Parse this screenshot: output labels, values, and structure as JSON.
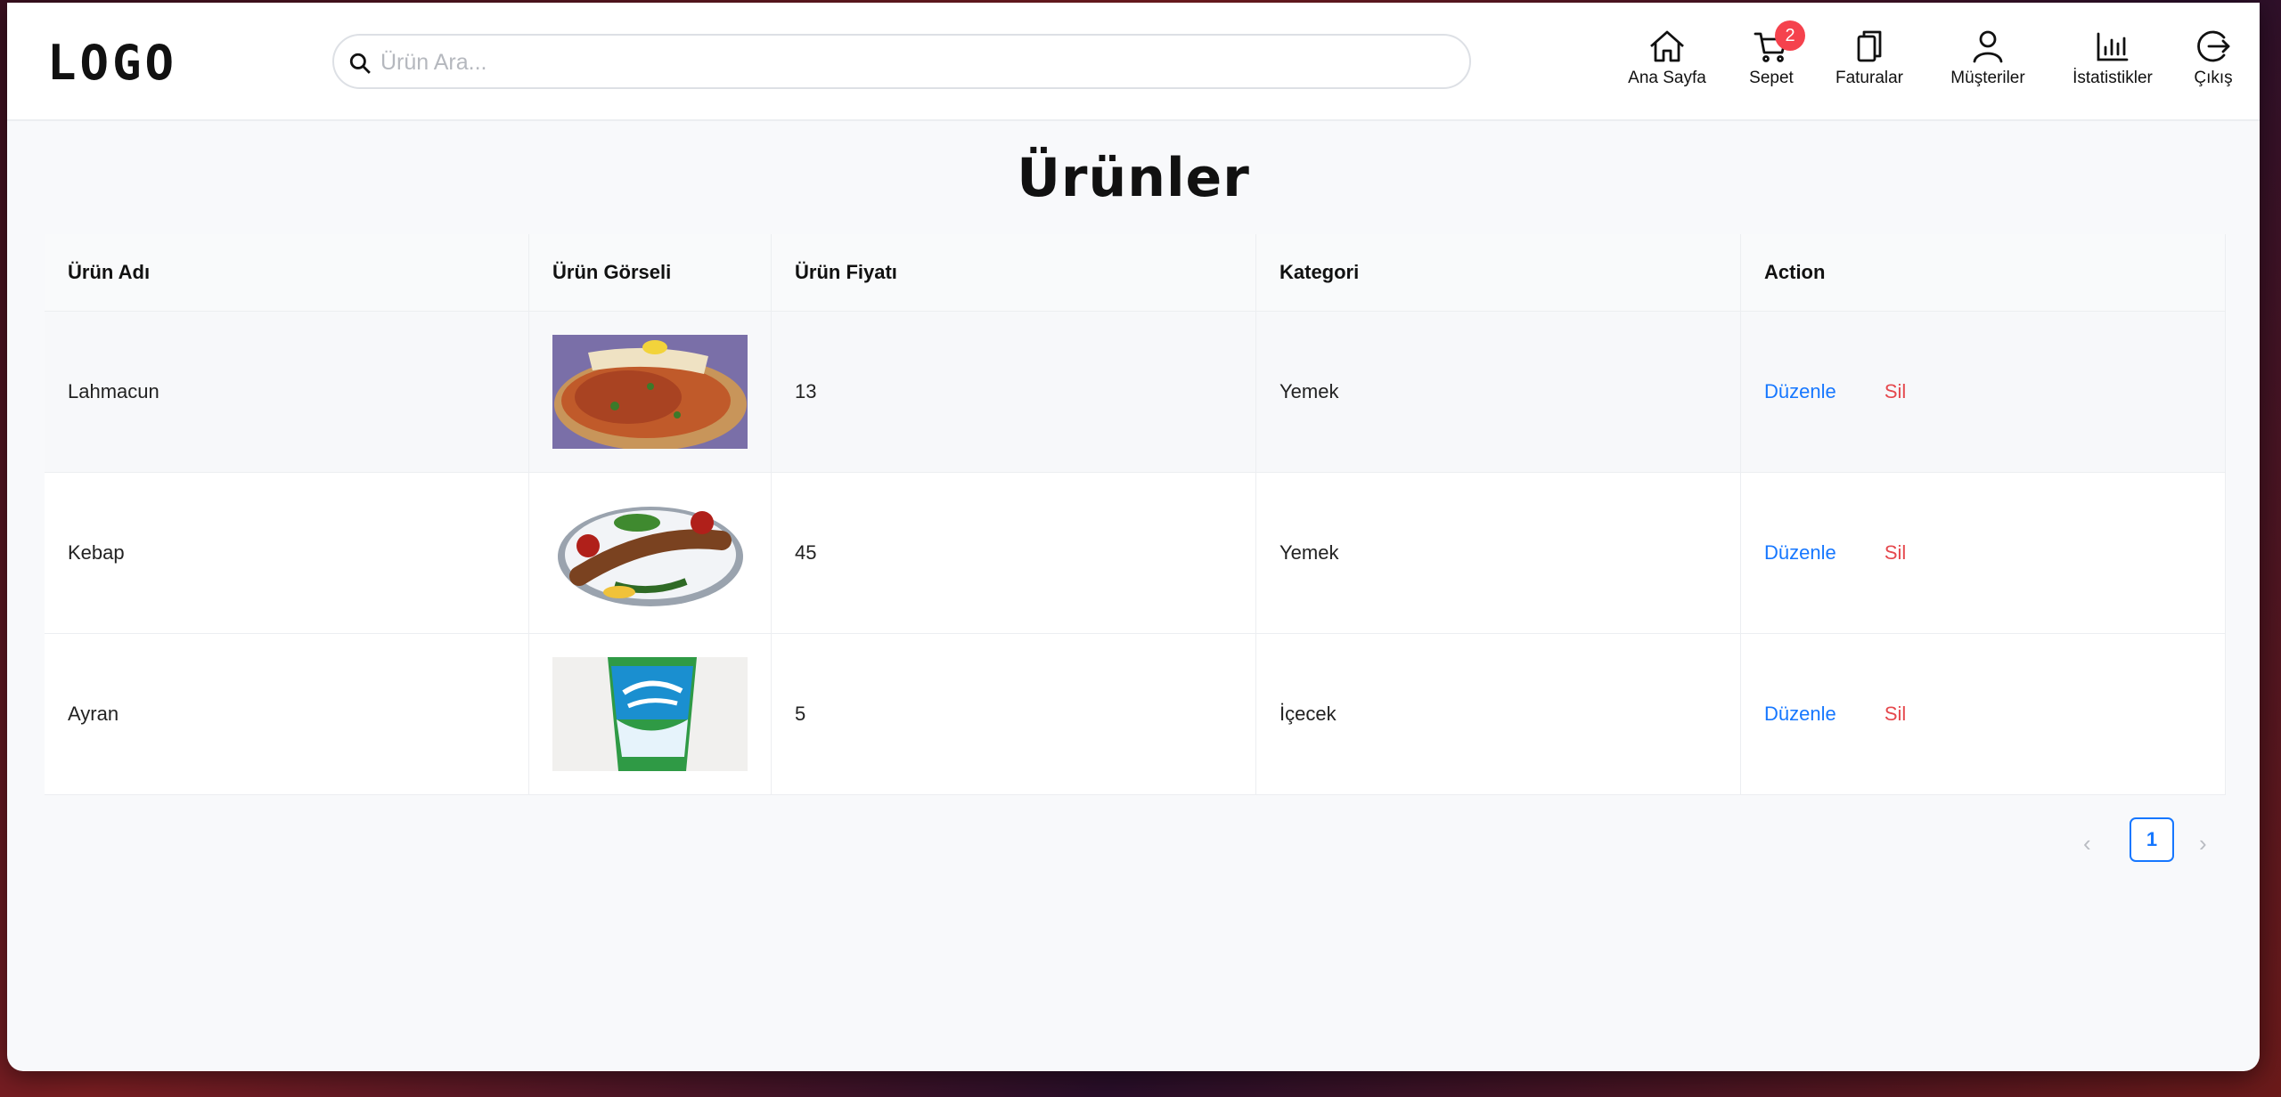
{
  "header": {
    "logo": "LOGO",
    "search_placeholder": "Ürün Ara...",
    "nav": [
      {
        "label": "Ana Sayfa",
        "icon": "home-icon"
      },
      {
        "label": "Sepet",
        "icon": "cart-icon",
        "badge": "2"
      },
      {
        "label": "Faturalar",
        "icon": "copy-icon"
      },
      {
        "label": "Müşteriler",
        "icon": "user-icon"
      },
      {
        "label": "İstatistikler",
        "icon": "bar-chart-icon"
      },
      {
        "label": "Çıkış",
        "icon": "logout-icon"
      }
    ]
  },
  "page": {
    "title": "Ürünler"
  },
  "table": {
    "columns": [
      "Ürün Adı",
      "Ürün Görseli",
      "Ürün Fiyatı",
      "Kategori",
      "Action"
    ],
    "rows": [
      {
        "name": "Lahmacun",
        "image": "lahmacun-image",
        "price": "13",
        "category": "Yemek",
        "edit": "Düzenle",
        "delete": "Sil"
      },
      {
        "name": "Kebap",
        "image": "kebap-image",
        "price": "45",
        "category": "Yemek",
        "edit": "Düzenle",
        "delete": "Sil"
      },
      {
        "name": "Ayran",
        "image": "ayran-image",
        "price": "5",
        "category": "İçecek",
        "edit": "Düzenle",
        "delete": "Sil"
      }
    ]
  },
  "pagination": {
    "current": "1",
    "prev": "‹",
    "next": "›"
  },
  "colors": {
    "accent": "#1677ff",
    "danger": "#e5484d",
    "badge": "#f5424d"
  }
}
